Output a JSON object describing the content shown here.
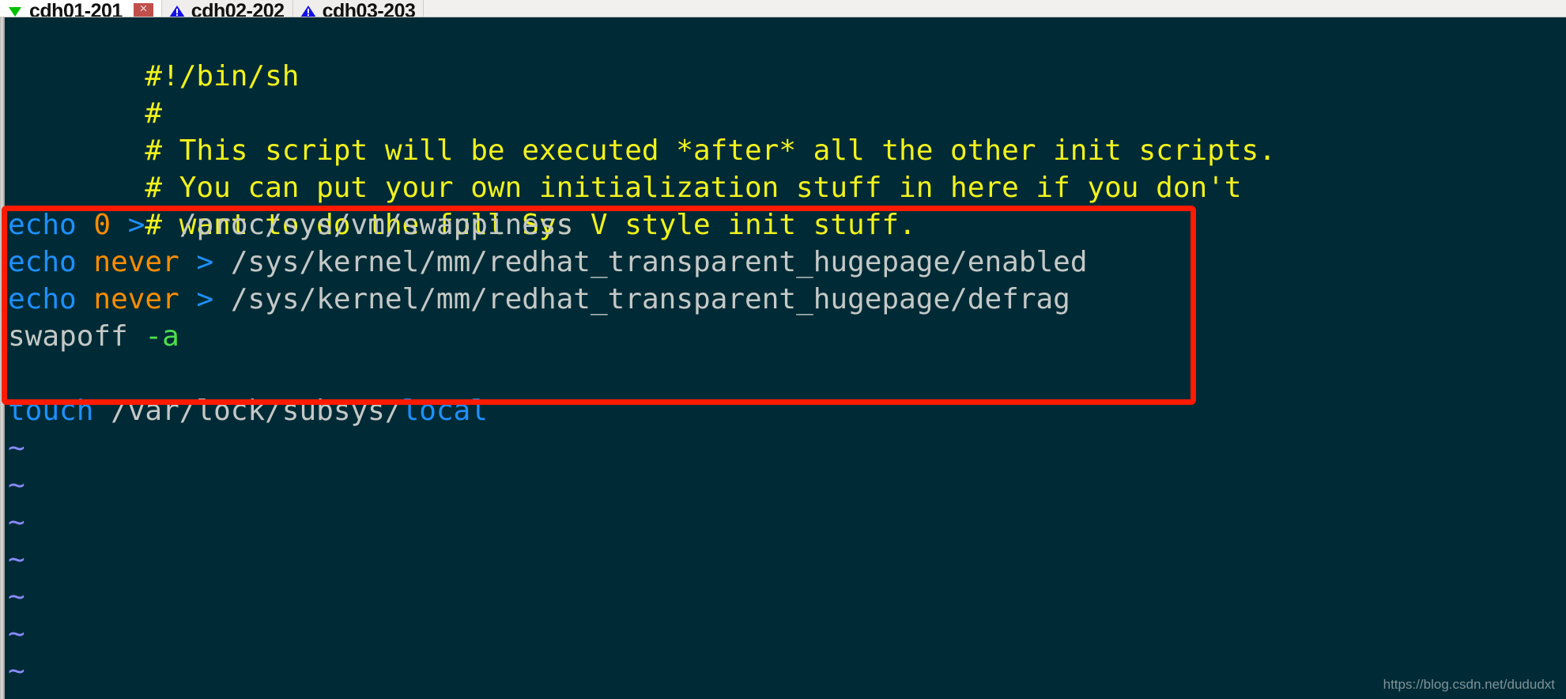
{
  "tabbar": {
    "tabs": [
      {
        "label": "cdh01-201",
        "icon": "green-triangle-down-icon",
        "state": "active",
        "has_close": true,
        "close_icon": "close-icon"
      },
      {
        "label": "cdh02-202",
        "icon": "blue-warning-triangle-icon",
        "state": "inactive",
        "has_close": false,
        "close_icon": ""
      },
      {
        "label": "cdh03-203",
        "icon": "blue-warning-triangle-icon",
        "state": "inactive",
        "has_close": false,
        "close_icon": ""
      }
    ]
  },
  "terminal": {
    "background_color": "#002b36",
    "comment_color": "#f2f21b",
    "keyword_color": "#1e90ff",
    "string_color": "#ff8c00",
    "path_color": "#c5c8c6",
    "flag_color": "#4ce04c",
    "tilde_color": "#8a8aff",
    "lines": {
      "l1": "#!/bin/sh",
      "l2": "#",
      "l3": "# This script will be executed *after* all the other init scripts.",
      "l4": "# You can put your own initialization stuff in here if you don't",
      "l5": "# want to do the full Sys V style init stuff.",
      "l6_cmd": "echo",
      "l6_val": "0",
      "l6_redir": ">",
      "l6_path": "/proc/sys/vm/swappiness",
      "l7_cmd": "echo",
      "l7_val": "never",
      "l7_redir": ">",
      "l7_path": "/sys/kernel/mm/redhat_transparent_hugepage/enabled",
      "l8_cmd": "echo",
      "l8_val": "never",
      "l8_redir": ">",
      "l8_path": "/sys/kernel/mm/redhat_transparent_hugepage/defrag",
      "l9_cmd": "swapoff",
      "l9_flag": "-a",
      "l10_cmd": "touch",
      "l10_path": "/var/lock/subsys/",
      "l10_tail": "local",
      "tilde": "~"
    }
  },
  "annotation": {
    "box_color": "#ff1a00"
  },
  "watermark": {
    "text": "https://blog.csdn.net/dududxt"
  }
}
